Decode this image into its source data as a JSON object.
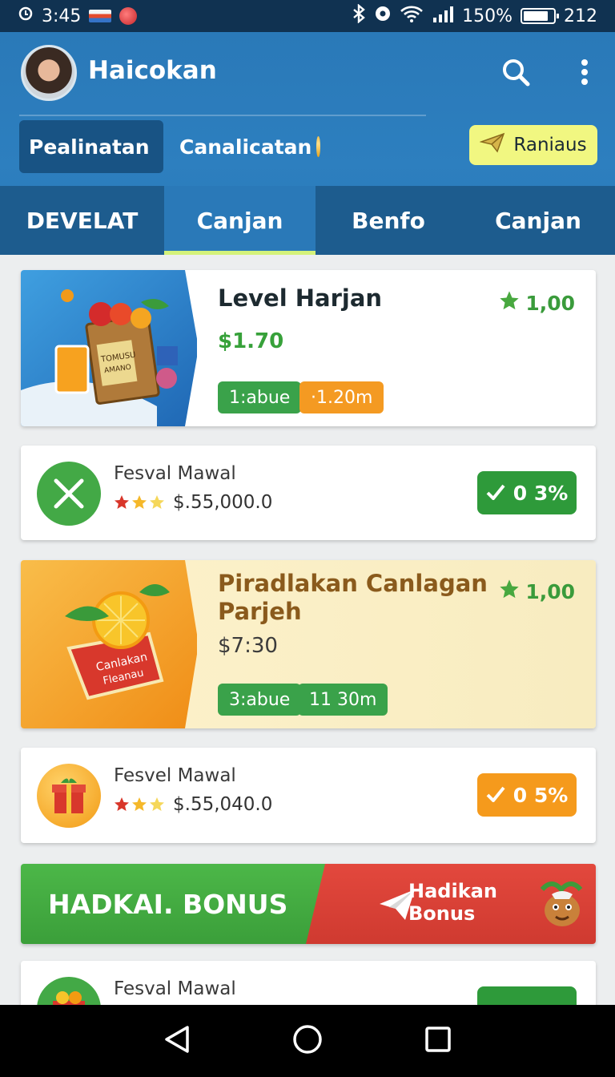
{
  "status_bar": {
    "time": "3:45",
    "battery_percent": "150%",
    "extra": "212",
    "colors": {
      "background": "#103251"
    }
  },
  "header": {
    "username": "Haicokan",
    "filters": [
      {
        "label": "Pealinatan",
        "active": true
      },
      {
        "label": "Canalicatan",
        "active": false
      }
    ],
    "action_button": "Raniaus",
    "icons": [
      "search-icon",
      "more-vert-icon",
      "paper-plane-icon"
    ]
  },
  "tabs": [
    {
      "label": "DEVELAT",
      "active": false
    },
    {
      "label": "Canjan",
      "active": true
    },
    {
      "label": "Benfo",
      "active": false
    },
    {
      "label": "Canjan",
      "active": false
    }
  ],
  "featured": [
    {
      "title": "Level Harjan",
      "price": "$1.70",
      "rating": "1,00",
      "chips": [
        "1:abue",
        "·1.20m"
      ],
      "image_box_text": [
        "TOMUSU",
        "AMANO"
      ]
    },
    {
      "title_line1": "Piradlakan Canlagan",
      "title_line2": "Parjeh",
      "price": "$7:30",
      "rating": "1,00",
      "chips": [
        "3:abue",
        "11 30m"
      ],
      "image_box_text": [
        "Canlakan",
        "Fleanau"
      ]
    }
  ],
  "list_items": [
    {
      "title": "Fesval Mawal",
      "amount": "$.55,000.0",
      "badge": "0 3%",
      "stars": 3,
      "icon": "close-icon"
    },
    {
      "title": "Fesvel Mawal",
      "amount": "$.55,040.0",
      "badge": "0 5%",
      "stars": 3,
      "icon": "gift-box-icon"
    },
    {
      "title": "Fesval Mawal",
      "icon": "gift-basket-icon"
    }
  ],
  "bonus_banner": {
    "left_text": "HADKAI. BONUS",
    "right_line1": "Hadikan",
    "right_line2": "Bonus"
  },
  "colors": {
    "header_blue": "#2a79b8",
    "tab_bar": "#1d5c8e",
    "green": "#3aa24a",
    "orange": "#f49a22",
    "red": "#e3483d"
  }
}
